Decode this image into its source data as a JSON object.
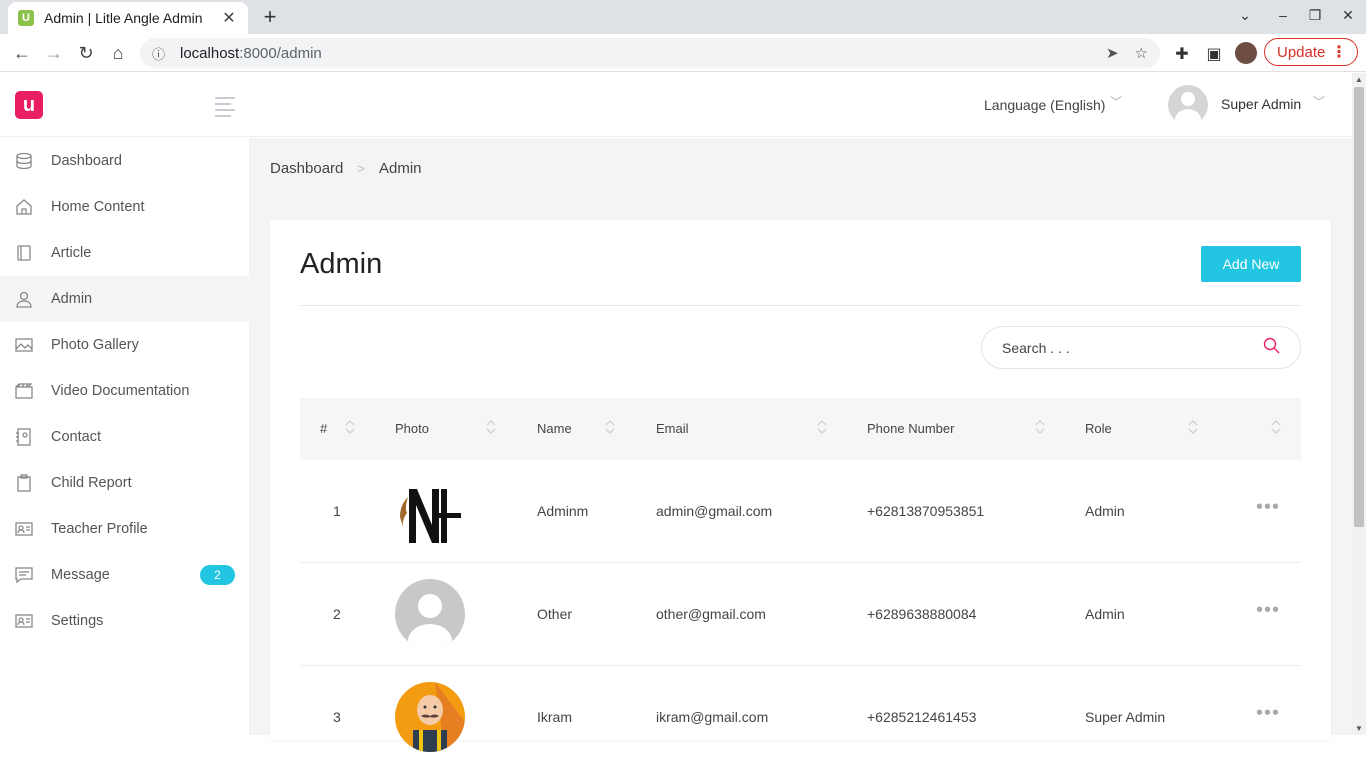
{
  "browser": {
    "tab_title": "Admin | Litle Angle Admin",
    "url_host": "localhost",
    "url_rest": ":8000/admin",
    "update_label": "Update"
  },
  "header": {
    "language": "Language (English)",
    "user_name": "Super Admin"
  },
  "sidebar": {
    "items": [
      {
        "label": "Dashboard",
        "icon": "database-icon"
      },
      {
        "label": "Home Content",
        "icon": "home-icon"
      },
      {
        "label": "Article",
        "icon": "article-icon"
      },
      {
        "label": "Admin",
        "icon": "user-icon",
        "active": true
      },
      {
        "label": "Photo Gallery",
        "icon": "gallery-icon"
      },
      {
        "label": "Video Documentation",
        "icon": "video-icon"
      },
      {
        "label": "Contact",
        "icon": "contact-book-icon"
      },
      {
        "label": "Child Report",
        "icon": "clipboard-icon"
      },
      {
        "label": "Teacher Profile",
        "icon": "id-card-icon"
      },
      {
        "label": "Message",
        "icon": "message-icon",
        "badge": "2"
      },
      {
        "label": "Settings",
        "icon": "settings-card-icon"
      }
    ]
  },
  "breadcrumb": {
    "home": "Dashboard",
    "current": "Admin"
  },
  "card": {
    "title": "Admin",
    "add_button": "Add New",
    "search_placeholder": "Search . . ."
  },
  "table": {
    "columns": [
      "#",
      "Photo",
      "Name",
      "Email",
      "Phone Number",
      "Role"
    ],
    "rows": [
      {
        "no": "1",
        "name": "Adminm",
        "email": "admin@gmail.com",
        "phone": "+62813870953851",
        "role": "Admin",
        "photo": "logo-photo"
      },
      {
        "no": "2",
        "name": "Other",
        "email": "other@gmail.com",
        "phone": "+6289638880084",
        "role": "Admin",
        "photo": "default-avatar"
      },
      {
        "no": "3",
        "name": "Ikram",
        "email": "ikram@gmail.com",
        "phone": "+6285212461453",
        "role": "Super Admin",
        "photo": "cartoon-avatar"
      }
    ]
  },
  "colors": {
    "accent": "#22c6e2",
    "brand": "#e91e63"
  }
}
